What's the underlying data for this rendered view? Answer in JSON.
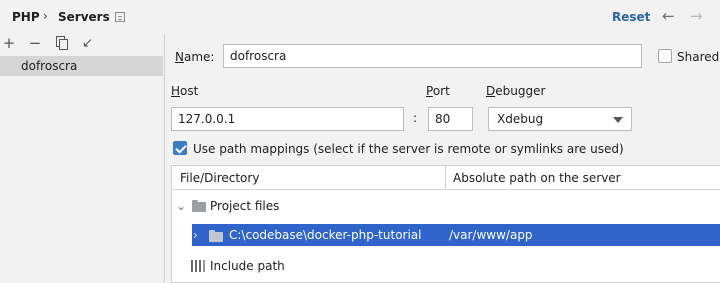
{
  "header": {
    "breadcrumb_1": "PHP",
    "breadcrumb_sep": "›",
    "breadcrumb_2": "Servers",
    "reset_label": "Reset",
    "back_glyph": "←",
    "forward_glyph": "→"
  },
  "toolbar": {
    "add_glyph": "+",
    "remove_glyph": "−",
    "move_glyph": "↙"
  },
  "server_list": {
    "items": [
      "dofroscra"
    ]
  },
  "form": {
    "name_label_ul": "N",
    "name_label_rest": "ame:",
    "name_value": "dofroscra",
    "shared_label": "Shared",
    "shared_checked": false,
    "host_label_ul": "H",
    "host_label_rest": "ost",
    "host_value": "127.0.0.1",
    "colon": ":",
    "port_label_ul": "P",
    "port_label_rest": "ort",
    "port_value": "80",
    "debugger_label_ul": "D",
    "debugger_label_rest": "ebugger",
    "debugger_value": "Xdebug",
    "use_mappings_checked": true,
    "use_mappings_label": "Use path mappings (select if the server is remote or symlinks are used)"
  },
  "mappings": {
    "col_file": "File/Directory",
    "col_server": "Absolute path on the server",
    "group_project": "Project files",
    "row_local": "C:\\codebase\\docker-php-tutorial",
    "row_remote": "/var/www/app",
    "group_include": "Include path"
  },
  "colors": {
    "accent": "#2a64ad",
    "selection": "#2f65ca",
    "checkbox": "#3c7ec4"
  },
  "icons": [
    "add-icon",
    "remove-icon",
    "copy-icon",
    "move-icon",
    "folder-icon",
    "library-icon",
    "chevron-right-icon",
    "chevron-down-icon",
    "arrow-left-icon",
    "arrow-right-icon",
    "settings-page-icon"
  ]
}
